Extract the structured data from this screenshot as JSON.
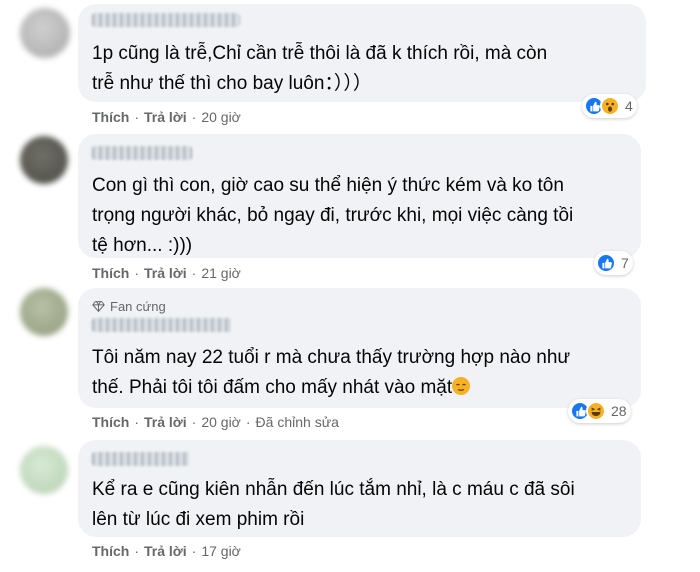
{
  "comments": [
    {
      "badge": "",
      "lines": [
        "1p cũng là trễ,Chỉ cần trễ thôi là đã k thích rồi, mà còn",
        "trễ như thế thì cho bay luôn：）））"
      ],
      "actions": {
        "like": "Thích",
        "reply": "Trả lời",
        "time": "20 giờ",
        "edited": ""
      },
      "reactions": {
        "types": [
          "like-icon",
          "wow-icon"
        ],
        "count": "4"
      }
    },
    {
      "badge": "",
      "lines": [
        "Con gì thì con, giờ cao su thể hiện ý thức kém và ko tôn",
        "trọng người khác, bỏ ngay đi, trước khi, mọi việc càng tồi",
        "tệ hơn... :)))"
      ],
      "actions": {
        "like": "Thích",
        "reply": "Trả lời",
        "time": "21 giờ",
        "edited": ""
      },
      "reactions": {
        "types": [
          "like-icon"
        ],
        "count": "7"
      }
    },
    {
      "badge": "Fan cứng",
      "lines": [
        "Tôi năm nay 22 tuổi r mà chưa thấy trường hợp nào như",
        "thế. Phải tôi tôi đấm cho mấy nhát vào mặt"
      ],
      "actions": {
        "like": "Thích",
        "reply": "Trả lời",
        "time": "20 giờ",
        "edited": "Đã chỉnh sửa"
      },
      "reactions": {
        "types": [
          "like-icon",
          "haha-icon"
        ],
        "count": "28"
      }
    },
    {
      "badge": "",
      "lines": [
        "Kể ra e cũng kiên nhẫn đến lúc tắm nhỉ, là c máu c đã sôi",
        "lên từ lúc đi xem phim rồi"
      ],
      "actions": {
        "like": "Thích",
        "reply": "Trả lời",
        "time": "17 giờ",
        "edited": ""
      },
      "reactions": {
        "types": [],
        "count": ""
      }
    }
  ],
  "colors": {
    "bubble": "#f0f2f5",
    "meta_text": "#65676b",
    "like_blue": "#1877f2",
    "emoji_yellow": "#f7b125"
  }
}
